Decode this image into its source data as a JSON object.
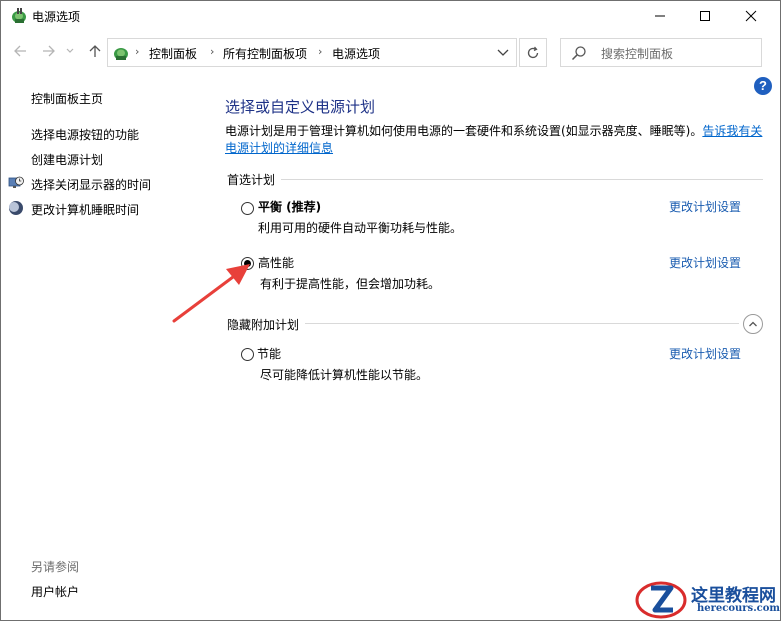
{
  "window": {
    "title": "电源选项"
  },
  "address": {
    "breadcrumbs": [
      "控制面板",
      "所有控制面板项",
      "电源选项"
    ],
    "search_placeholder": "搜索控制面板"
  },
  "help_label": "?",
  "left_pane": {
    "home_link": "控制面板主页",
    "links": [
      {
        "label": "选择电源按钮的功能",
        "icon": "none"
      },
      {
        "label": "创建电源计划",
        "icon": "none"
      },
      {
        "label": "选择关闭显示器的时间",
        "icon": "monitor-clock-icon"
      },
      {
        "label": "更改计算机睡眠时间",
        "icon": "moon-icon"
      }
    ],
    "see_also": "另请参阅",
    "see_also_links": [
      "用户帐户"
    ]
  },
  "main": {
    "title": "选择或自定义电源计划",
    "description": "电源计划是用于管理计算机如何使用电源的一套硬件和系统设置(如显示器亮度、睡眠等)。",
    "description_link": "告诉我有关电源计划的详细信息",
    "preferred_section": "首选计划",
    "hidden_section": "隐藏附加计划",
    "plans": [
      {
        "name": "平衡 (推荐)",
        "desc": "利用可用的硬件自动平衡功耗与性能。",
        "link": "更改计划设置",
        "selected": false
      },
      {
        "name": "高性能",
        "desc": "有利于提高性能，但会增加功耗。",
        "link": "更改计划设置",
        "selected": true
      },
      {
        "name": "节能",
        "desc": "尽可能降低计算机性能以节能。",
        "link": "更改计划设置",
        "selected": false
      }
    ]
  },
  "watermark": {
    "text_cn": "这里教程网",
    "text_url": "herecours.com"
  },
  "colors": {
    "title_blue": "#1e3287",
    "link_blue": "#1a5cb0",
    "arrow_red": "#e8403a"
  }
}
